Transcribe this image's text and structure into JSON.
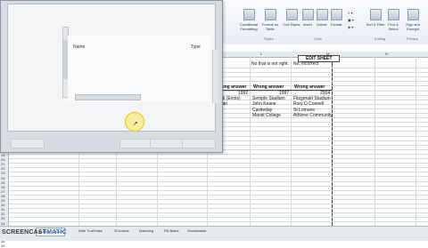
{
  "ribbon": {
    "buttons": [
      {
        "id": "cond",
        "label": "Conditional Formatting"
      },
      {
        "id": "fmt",
        "label": "Format as Table"
      },
      {
        "id": "styles",
        "label": "Cell Styles"
      },
      {
        "id": "insert",
        "label": "Insert"
      },
      {
        "id": "delete",
        "label": "Delete"
      },
      {
        "id": "format",
        "label": "Format"
      },
      {
        "id": "sort",
        "label": "Sort & Filter"
      },
      {
        "id": "find",
        "label": "Find & Select"
      },
      {
        "id": "sign",
        "label": "Sign and Encrypt"
      }
    ],
    "groups": {
      "styles": "Styles",
      "cells": "Cells",
      "editing": "Editing",
      "privacy": "Privacy"
    }
  },
  "sheet": {
    "columns": [
      "L",
      "M",
      "N"
    ],
    "edit_sheet": "EDIT SHEET",
    "notice_left": "No that is not right.",
    "notice_right": "No, incorrect",
    "headers": [
      "Wrong answer",
      "Wrong answer",
      "Wrong answer"
    ],
    "years": [
      "1992",
      "1997",
      "2004"
    ],
    "col1": [
      "Park (Ennis)",
      "Nolan",
      "",
      "lan"
    ],
    "col2": [
      "Semple Stadium",
      "John Keane",
      "Castleday",
      "Marist College"
    ],
    "col3": [
      "Fitzgerald Stadium",
      "Rory O Connell",
      "St Lomans",
      "Athlone Community"
    ],
    "rows": [
      "19",
      "20",
      "21",
      "22",
      "23",
      "24",
      "25",
      "26",
      "27",
      "28",
      "29",
      "30",
      "31",
      "32",
      "33",
      "34",
      "35",
      "36",
      "37",
      "38",
      "39"
    ]
  },
  "dialog": {
    "list_header_name": "Name",
    "list_header_type": "Type"
  },
  "tabs": [
    "Multiple Choice",
    "With TrueFalse",
    "3Choices",
    "Matching",
    "Fill-Blank",
    "Wordstrable"
  ],
  "watermark": {
    "a": "SCREENCAST",
    "b": "MATIC"
  }
}
